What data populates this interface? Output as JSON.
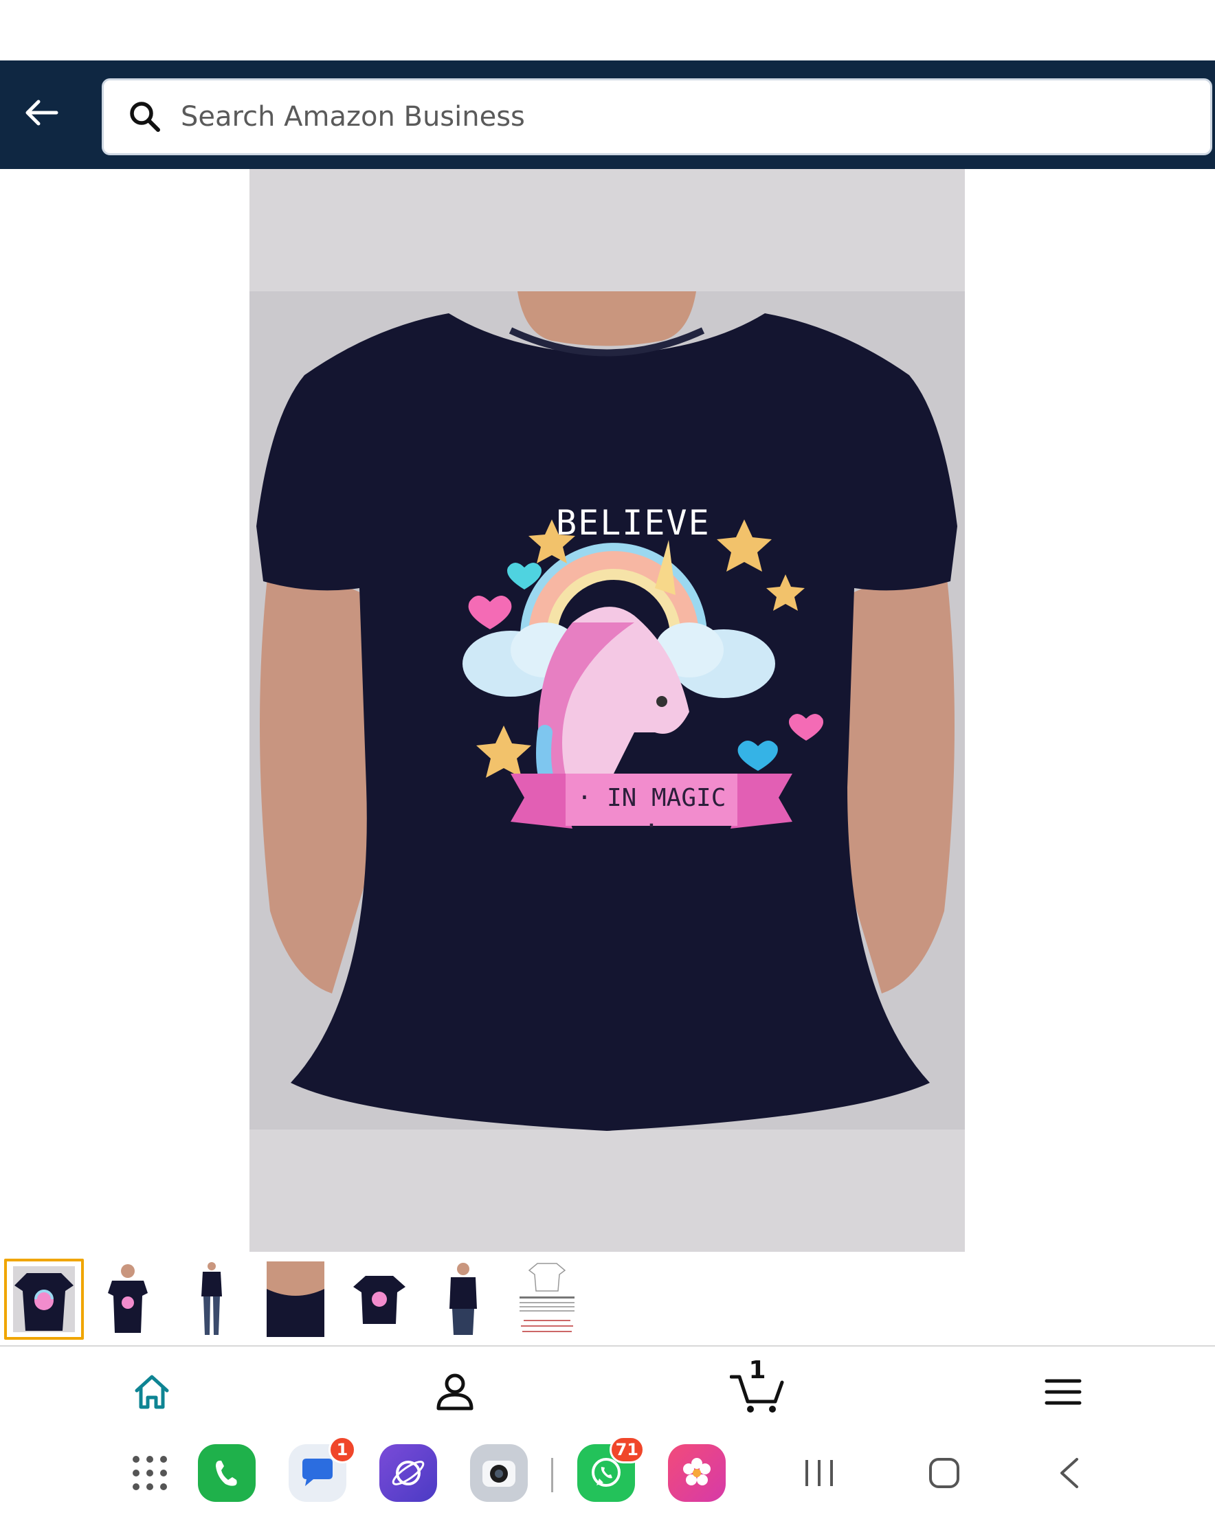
{
  "header": {
    "back_label": "Back",
    "search_placeholder": "Search Amazon Business"
  },
  "product": {
    "design_text_top": "BELIEVE",
    "design_text_bottom": "· IN MAGIC ·",
    "thumbnails": [
      {
        "name": "front-print"
      },
      {
        "name": "model-front"
      },
      {
        "name": "model-full"
      },
      {
        "name": "neck-closeup"
      },
      {
        "name": "flat-lay"
      },
      {
        "name": "model-side"
      },
      {
        "name": "size-chart"
      }
    ],
    "selected_thumbnail": 0
  },
  "bottom_nav": {
    "items": [
      "home-icon",
      "account-icon",
      "cart-icon",
      "menu-icon"
    ],
    "cart_count": "1",
    "active": "home"
  },
  "dock": {
    "apps": [
      "apps-grid",
      "phone",
      "messages",
      "internet",
      "camera",
      "whatsapp",
      "gallery"
    ],
    "messages_badge": "1",
    "whatsapp_badge": "71"
  },
  "colors": {
    "header_bg": "#0f2742",
    "accent_teal": "#0e8493",
    "thumb_selected": "#f0a500",
    "shirt": "#141530"
  }
}
